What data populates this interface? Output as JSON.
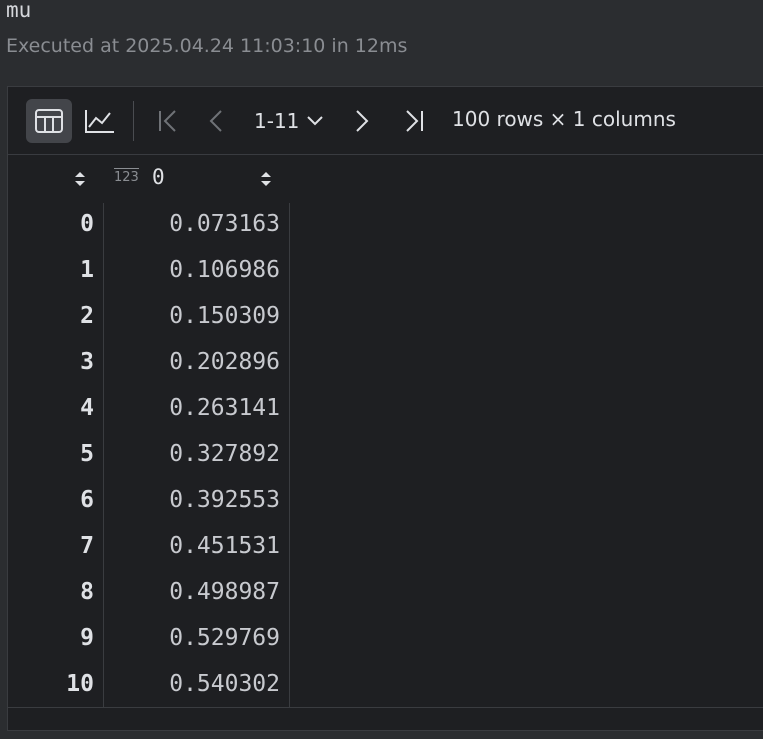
{
  "cell": {
    "name": "mu",
    "executed_text": "Executed at 2025.04.24 11:03:10 in 12ms"
  },
  "toolbar": {
    "table_view_icon": "table-icon",
    "chart_view_icon": "line-chart-icon",
    "first_page_icon": "first-page-icon",
    "prev_page_icon": "chevron-left-icon",
    "page_range": "1-11",
    "page_range_icon": "chevron-down-icon",
    "next_page_icon": "chevron-right-icon",
    "last_page_icon": "last-page-icon",
    "summary": "100 rows × 1 columns"
  },
  "table": {
    "column_type_badge": "123",
    "column_name": "0",
    "rows": [
      {
        "index": "0",
        "value": "0.073163"
      },
      {
        "index": "1",
        "value": "0.106986"
      },
      {
        "index": "2",
        "value": "0.150309"
      },
      {
        "index": "3",
        "value": "0.202896"
      },
      {
        "index": "4",
        "value": "0.263141"
      },
      {
        "index": "5",
        "value": "0.327892"
      },
      {
        "index": "6",
        "value": "0.392553"
      },
      {
        "index": "7",
        "value": "0.451531"
      },
      {
        "index": "8",
        "value": "0.498987"
      },
      {
        "index": "9",
        "value": "0.529769"
      },
      {
        "index": "10",
        "value": "0.540302"
      }
    ]
  },
  "colors": {
    "background": "#2b2d30",
    "panel": "#1e1f22",
    "text": "#dfe1e5",
    "muted": "#8a8d92",
    "active_button": "#43454a"
  }
}
